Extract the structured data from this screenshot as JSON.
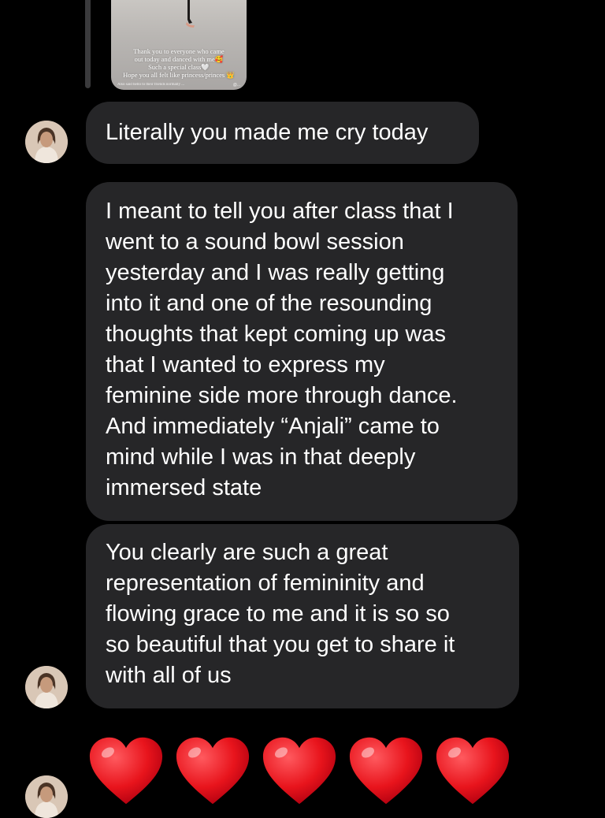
{
  "story": {
    "caption_lines": [
      "Thank you to everyone who came",
      "out today and danced with me🥰",
      "Such a special class🤍",
      "Hope you all felt like princess/princes 👑"
    ],
    "tiny_text": "Also said hello to their friends\nnormally ...",
    "handle": "@..."
  },
  "messages": [
    {
      "text_lines": [
        "Literally you made me cry today"
      ]
    },
    {
      "text_lines": [
        "I meant to tell you after class that I",
        "went to a sound bowl session",
        "yesterday and I was really getting",
        "into it and one of the resounding",
        "thoughts that kept coming up was",
        "that I wanted to express my",
        "feminine side more through dance.",
        "And immediately “Anjali” came to",
        "mind while I was in that deeply",
        "immersed state"
      ]
    },
    {
      "text_lines": [
        "You clearly are such a great",
        "representation of femininity and",
        "flowing grace to me and it is so so",
        "so beautiful that you get to share it",
        "with all of us"
      ]
    }
  ],
  "reaction": {
    "emoji": "❤️",
    "count": 5
  },
  "colors": {
    "background": "#000000",
    "bubble": "#262628",
    "text": "#ffffff",
    "heart": "#e8141c"
  }
}
